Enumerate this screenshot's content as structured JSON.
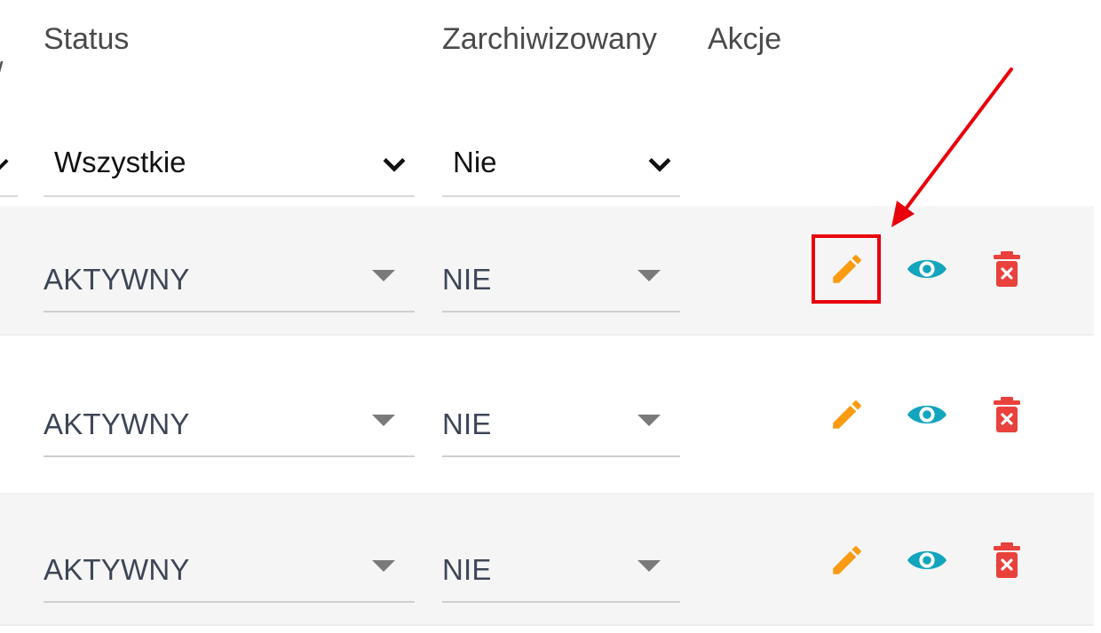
{
  "header": {
    "status_label": "Status",
    "archived_label": "Zarchiwizowany",
    "actions_label": "Akcje",
    "partial_slash": "/"
  },
  "filters": {
    "status": {
      "selected": "Wszystkie"
    },
    "archived": {
      "selected": "Nie"
    }
  },
  "rows": [
    {
      "status": "AKTYWNY",
      "archived": "NIE"
    },
    {
      "status": "AKTYWNY",
      "archived": "NIE"
    },
    {
      "status": "AKTYWNY",
      "archived": "NIE"
    }
  ],
  "colors": {
    "edit": "#fb9b11",
    "view": "#12a5bd",
    "delete": "#e9413c",
    "highlight": "#e8000b",
    "row_shade": "#f5f5f5"
  },
  "icons": {
    "edit": "pencil-icon",
    "view": "eye-icon",
    "delete": "trash-x-icon",
    "dropdown": "chevron-down-icon",
    "caret": "caret-down-icon"
  }
}
